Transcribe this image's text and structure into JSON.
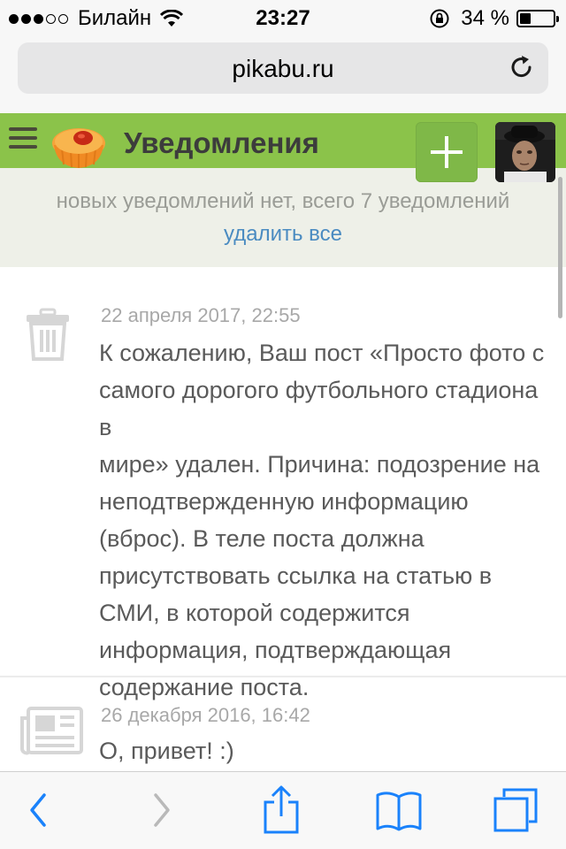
{
  "status_bar": {
    "carrier": "Билайн",
    "time": "23:27",
    "battery_percent_label": "34 %",
    "battery_level": 0.34
  },
  "browser": {
    "url": "pikabu.ru"
  },
  "header": {
    "title": "Уведомления"
  },
  "summary": {
    "count_text": "новых уведомлений нет, всего 7 уведомлений",
    "delete_all": "удалить все"
  },
  "notifications": [
    {
      "icon": "trash-icon",
      "date": "22 апреля 2017, 22:55",
      "lines": [
        "К сожалению, Ваш пост «Просто фото с",
        "самого дорогого футбольного стадиона в",
        "мире» удален. Причина: подозрение на",
        "неподтвержденную информацию",
        "(вброс). В теле поста должна",
        "присутствовать ссылка на статью в",
        "СМИ, в которой содержится",
        "информация, подтверждающая",
        "содержание поста."
      ]
    },
    {
      "icon": "newspaper-icon",
      "date": "26 декабря 2016, 16:42",
      "lines": [
        "О, привет! :)"
      ]
    }
  ],
  "colors": {
    "header_green": "#8bc34a",
    "summary_bg": "#eef0e8",
    "link_blue": "#4a8bc1",
    "ios_blue": "#1a82fb"
  }
}
